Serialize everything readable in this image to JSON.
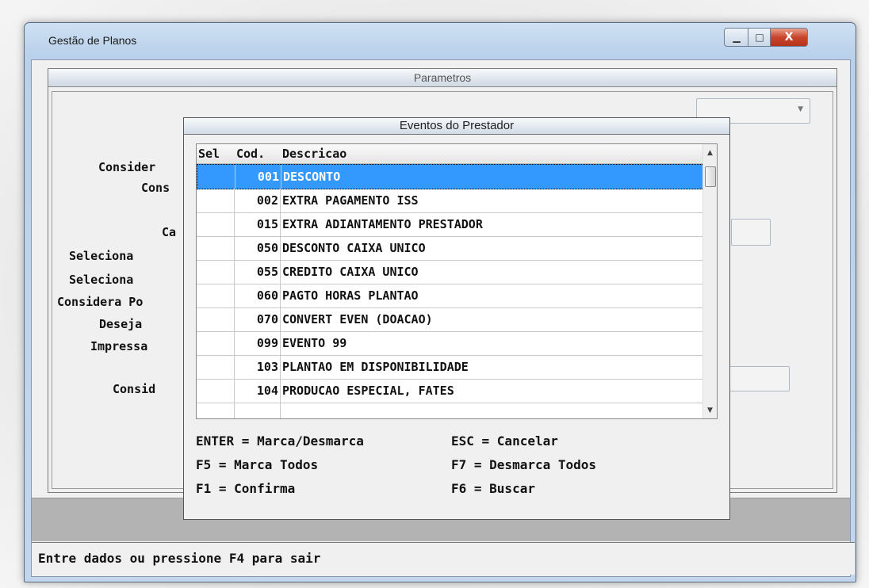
{
  "window": {
    "title": "Gestão de Planos",
    "min_glyph": "▁",
    "max_glyph": "□",
    "close_glyph": "X"
  },
  "parametros": {
    "header": "Parametros",
    "labels": [
      "Consider",
      "Cons",
      "Ca",
      "Seleciona",
      "Seleciona",
      "Considera Po",
      "Deseja",
      "Impressa",
      "Consid"
    ],
    "right_label": "?:"
  },
  "popup": {
    "title": "Eventos do Prestador",
    "columns": {
      "sel": "Sel",
      "cod": "Cod.",
      "desc": "Descricao"
    },
    "rows": [
      {
        "sel": "",
        "cod": "001",
        "desc": "DESCONTO",
        "selected": true
      },
      {
        "sel": "",
        "cod": "002",
        "desc": "EXTRA PAGAMENTO ISS"
      },
      {
        "sel": "",
        "cod": "015",
        "desc": "EXTRA ADIANTAMENTO PRESTADOR"
      },
      {
        "sel": "",
        "cod": "050",
        "desc": "DESCONTO CAIXA UNICO"
      },
      {
        "sel": "",
        "cod": "055",
        "desc": "CREDITO CAIXA UNICO"
      },
      {
        "sel": "",
        "cod": "060",
        "desc": "PAGTO HORAS PLANTAO"
      },
      {
        "sel": "",
        "cod": "070",
        "desc": "CONVERT EVEN (DOACAO)"
      },
      {
        "sel": "",
        "cod": "099",
        "desc": "EVENTO 99"
      },
      {
        "sel": "",
        "cod": "103",
        "desc": "PLANTAO EM DISPONIBILIDADE"
      },
      {
        "sel": "",
        "cod": "104",
        "desc": "PRODUCAO ESPECIAL, FATES"
      }
    ],
    "help": {
      "enter": "ENTER = Marca/Desmarca",
      "esc": "ESC = Cancelar",
      "f5": "F5 = Marca Todos",
      "f7": "F7 = Desmarca Todos",
      "f1": "F1 = Confirma",
      "f6": "F6 = Buscar"
    }
  },
  "status": "Entre dados ou pressione F4 para sair"
}
